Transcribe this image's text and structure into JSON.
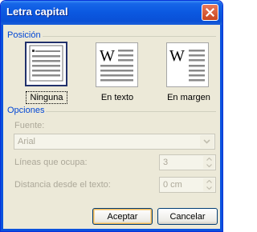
{
  "window": {
    "title": "Letra capital"
  },
  "position_section": {
    "label": "Posición",
    "options": [
      {
        "label": "Ninguna",
        "selected": true
      },
      {
        "label": "En texto",
        "selected": false
      },
      {
        "label": "En margen",
        "selected": false
      }
    ],
    "glyph": "W"
  },
  "options_section": {
    "label": "Opciones",
    "font": {
      "label": "Fuente:",
      "value": "Arial"
    },
    "lines": {
      "label": "Líneas que ocupa:",
      "value": "3"
    },
    "distance": {
      "label": "Distancia desde el texto:",
      "value": "0 cm"
    }
  },
  "buttons": {
    "ok": "Aceptar",
    "cancel": "Cancelar"
  },
  "colors": {
    "title_bar": "#0b58e0",
    "section_label": "#0046d5",
    "disabled_text": "#aca899"
  }
}
